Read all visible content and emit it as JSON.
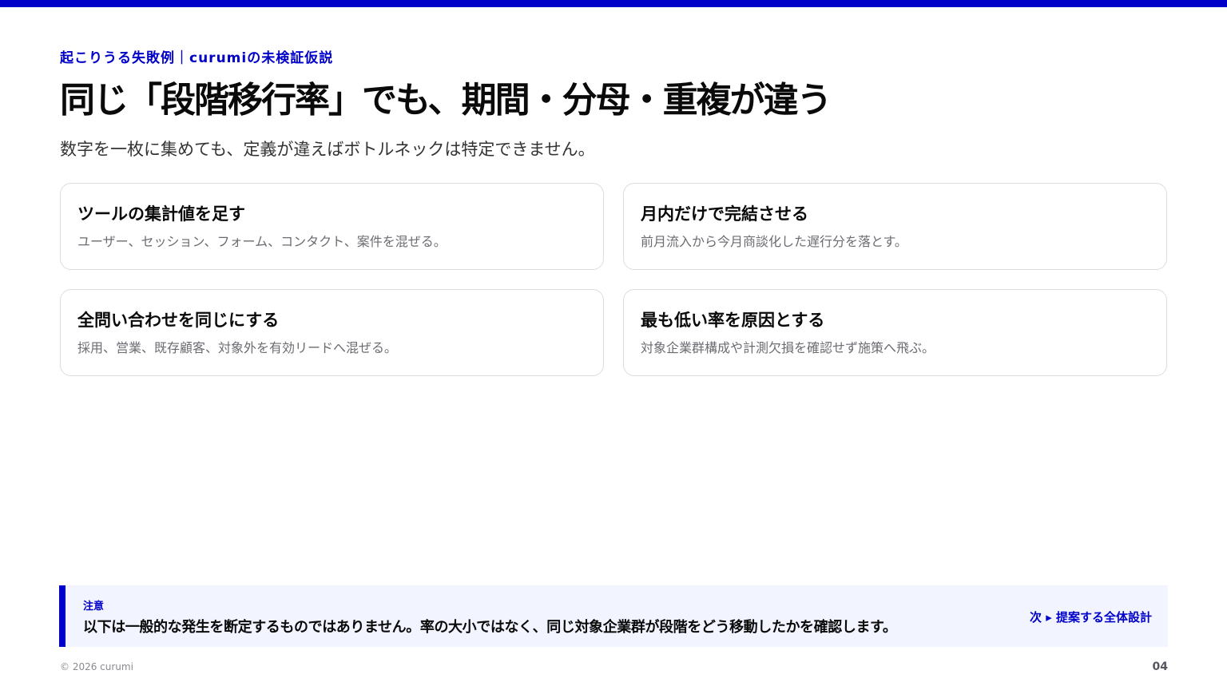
{
  "colors": {
    "accent": "#0000c8",
    "note_background": "#f2f5ff",
    "card_border": "#dcdce2"
  },
  "header": {
    "eyebrow": "起こりうる失敗例｜curumiの未検証仮説",
    "title": "同じ「段階移行率」でも、期間・分母・重複が違う",
    "subtitle": "数字を一枚に集めても、定義が違えばボトルネックは特定できません。"
  },
  "cards": [
    {
      "title": "ツールの集計値を足す",
      "description": "ユーザー、セッション、フォーム、コンタクト、案件を混ぜる。"
    },
    {
      "title": "月内だけで完結させる",
      "description": "前月流入から今月商談化した遅行分を落とす。"
    },
    {
      "title": "全問い合わせを同じにする",
      "description": "採用、営業、既存顧客、対象外を有効リードへ混ぜる。"
    },
    {
      "title": "最も低い率を原因とする",
      "description": "対象企業群構成や計測欠損を確認せず施策へ飛ぶ。"
    }
  ],
  "note": {
    "label": "注意",
    "text": "以下は一般的な発生を断定するものではありません。率の大小ではなく、同じ対象企業群が段階をどう移動したかを確認します。",
    "next_label": "次 ▸ 提案する全体設計"
  },
  "footer": {
    "copyright": "© 2026 curumi",
    "page_number": "04"
  }
}
